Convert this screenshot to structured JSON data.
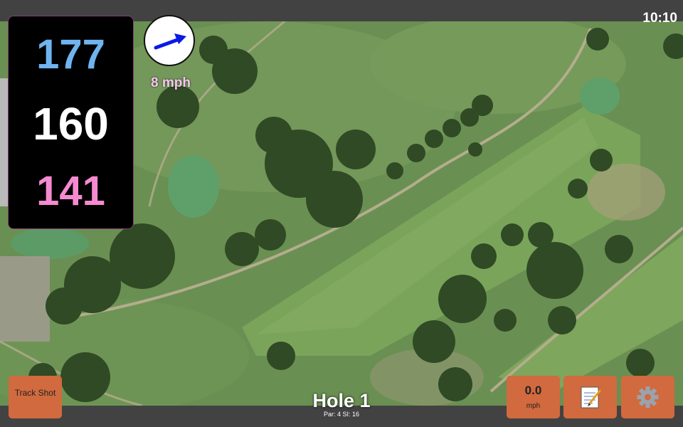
{
  "status_bar": {
    "time": "10:10"
  },
  "yardages": {
    "back": "177",
    "middle": "160",
    "front": "141",
    "colors": {
      "back": "#6fb4f0",
      "middle": "#ffffff",
      "front": "#f58ad1"
    }
  },
  "wind": {
    "speed": "8 mph",
    "icon": "wind-direction-arrow-icon"
  },
  "buttons": {
    "track_shot": "Track Shot",
    "speed_value": "0.0",
    "speed_unit": "mph",
    "notes_icon": "notepad-icon",
    "settings_icon": "gear-icon"
  },
  "hole": {
    "title": "Hole 1",
    "info": "Par: 4    SI: 16"
  },
  "map": {
    "type": "satellite-golf-course"
  }
}
